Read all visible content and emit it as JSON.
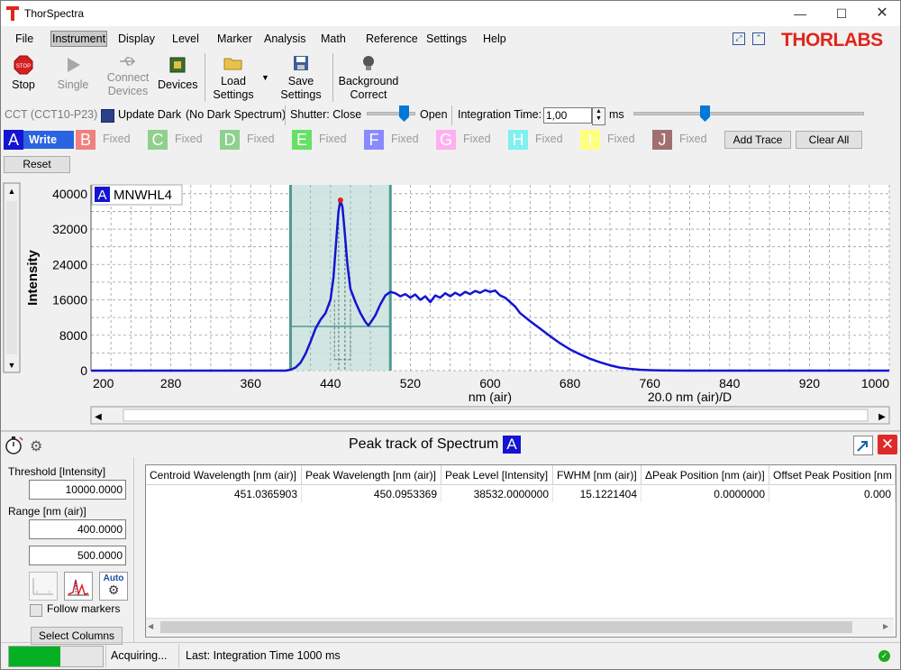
{
  "window": {
    "title": "ThorSpectra",
    "brand": "THORLABS"
  },
  "menu": [
    "File",
    "Instrument",
    "Display",
    "Level",
    "Marker",
    "Analysis",
    "Math",
    "Reference",
    "Settings",
    "Help"
  ],
  "menu_active": "Instrument",
  "toolbar": {
    "stop": "Stop",
    "single": "Single",
    "connect_l1": "Connect",
    "connect_l2": "Devices",
    "devices": "Devices",
    "load_l1": "Load",
    "load_l2": "Settings",
    "save_l1": "Save",
    "save_l2": "Settings",
    "bg_l1": "Background",
    "bg_l2": "Correct"
  },
  "device_bar": {
    "device": "CCT (CCT10-P23)",
    "update_dark": "Update Dark",
    "dark_status": "(No Dark Spectrum)",
    "shutter_label": "Shutter: Close",
    "shutter_open": "Open",
    "integration_label": "Integration Time:",
    "integration_value": "1,00",
    "integration_unit": "ms"
  },
  "traces": [
    {
      "letter": "A",
      "state": "Write",
      "color": "#1414d2"
    },
    {
      "letter": "B",
      "state": "Fixed",
      "color": "#f08080"
    },
    {
      "letter": "C",
      "state": "Fixed",
      "color": "#8fd08f"
    },
    {
      "letter": "D",
      "state": "Fixed",
      "color": "#8fd08f"
    },
    {
      "letter": "E",
      "state": "Fixed",
      "color": "#66e066"
    },
    {
      "letter": "F",
      "state": "Fixed",
      "color": "#8a8aff"
    },
    {
      "letter": "G",
      "state": "Fixed",
      "color": "#ffb0f0"
    },
    {
      "letter": "H",
      "state": "Fixed",
      "color": "#80f0f0"
    },
    {
      "letter": "I",
      "state": "Fixed",
      "color": "#ffff80"
    },
    {
      "letter": "J",
      "state": "Fixed",
      "color": "#a07070"
    }
  ],
  "buttons": {
    "add_trace": "Add Trace",
    "clear_all": "Clear All",
    "reset": "Reset",
    "select_columns": "Select Columns"
  },
  "chart_data": {
    "type": "line",
    "legend": {
      "letter": "A",
      "name": "MNWHL4"
    },
    "ylabel": "Intensity",
    "xlabel": "nm (air)",
    "xscale_label": "20.0 nm (air)/D",
    "xlim": [
      200,
      1000
    ],
    "ylim": [
      0,
      42000
    ],
    "xticks": [
      "200",
      "280",
      "360",
      "440",
      "520",
      "600",
      "680",
      "760",
      "840",
      "920",
      "1000"
    ],
    "yticks": [
      "40000",
      "32000",
      "24000",
      "16000",
      "8000",
      "0"
    ],
    "grid": true,
    "roi": {
      "x_start": 400,
      "x_end": 500,
      "threshold": 10000
    },
    "peak": {
      "x": 450,
      "y": 38532
    },
    "series": [
      {
        "color": "#1414d2",
        "x": [
          200,
          395,
          400,
          405,
          410,
          415,
          420,
          425,
          430,
          435,
          440,
          443,
          446,
          448,
          450,
          452,
          454,
          457,
          460,
          465,
          470,
          475,
          478,
          480,
          485,
          490,
          495,
          500,
          505,
          510,
          515,
          520,
          525,
          530,
          535,
          540,
          545,
          550,
          555,
          560,
          565,
          570,
          575,
          580,
          585,
          590,
          595,
          600,
          605,
          610,
          615,
          620,
          625,
          630,
          640,
          650,
          660,
          670,
          680,
          690,
          700,
          710,
          720,
          730,
          740,
          750,
          760,
          770,
          780,
          800,
          820,
          850,
          900,
          1000
        ],
        "y": [
          0,
          0,
          200,
          700,
          1800,
          3800,
          6500,
          9500,
          11500,
          13000,
          16000,
          21000,
          30000,
          36000,
          38500,
          37000,
          32000,
          24000,
          18500,
          15500,
          13000,
          11000,
          10200,
          10800,
          12500,
          15000,
          17000,
          17800,
          17500,
          16800,
          17300,
          16500,
          17200,
          16000,
          16800,
          15500,
          17000,
          16500,
          17500,
          16800,
          17600,
          17000,
          17800,
          17300,
          18000,
          17600,
          18200,
          17800,
          18100,
          17000,
          16500,
          15500,
          14500,
          13000,
          11200,
          9500,
          7800,
          6200,
          4800,
          3700,
          2700,
          1900,
          1200,
          700,
          400,
          200,
          100,
          50,
          20,
          0,
          0,
          0,
          0,
          0
        ]
      }
    ]
  },
  "peak_panel": {
    "title": "Peak track of Spectrum",
    "spectrum": "A",
    "threshold_label": "Threshold [Intensity]",
    "threshold_value": "10000.0000",
    "range_label": "Range [nm (air)]",
    "range_min": "400.0000",
    "range_max": "500.0000",
    "follow_markers": "Follow markers",
    "auto_label": "Auto",
    "columns": [
      "Centroid Wavelength [nm (air)]",
      "Peak Wavelength [nm (air)]",
      "Peak Level [Intensity]",
      "FWHM [nm (air)]",
      "ΔPeak Position [nm (air)]",
      "Offset Peak Position [nm"
    ],
    "rows": [
      [
        "451.0365903",
        "450.0953369",
        "38532.0000000",
        "15.1221404",
        "0.0000000",
        "0.000"
      ]
    ]
  },
  "status": {
    "acquiring": "Acquiring...",
    "last": "Last: Integration Time 1000 ms",
    "progress": 0.55,
    "ok_color": "#1fa81f"
  }
}
